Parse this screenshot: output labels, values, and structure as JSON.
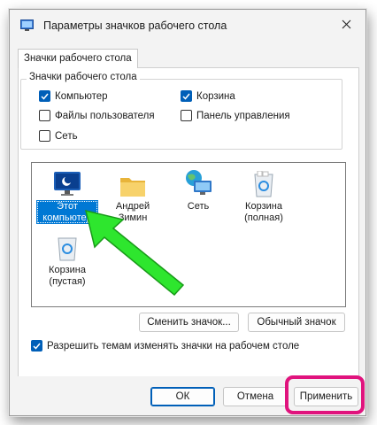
{
  "window": {
    "title": "Параметры значков рабочего стола"
  },
  "tab": {
    "label": "Значки рабочего стола"
  },
  "group": {
    "legend": "Значки рабочего стола",
    "checkboxes": [
      {
        "label": "Компьютер",
        "checked": true
      },
      {
        "label": "Корзина",
        "checked": true
      },
      {
        "label": "Файлы пользователя",
        "checked": false
      },
      {
        "label": "Панель управления",
        "checked": false
      },
      {
        "label": "Сеть",
        "checked": false
      }
    ]
  },
  "icons": [
    {
      "label": "Этот компьютер",
      "icon": "monitor-icon",
      "selected": true
    },
    {
      "label": "Андрей Зимин",
      "icon": "folder-icon",
      "selected": false
    },
    {
      "label": "Сеть",
      "icon": "network-icon",
      "selected": false
    },
    {
      "label": "Корзина (полная)",
      "icon": "recycle-bin-full-icon",
      "selected": false
    },
    {
      "label": "Корзина (пустая)",
      "icon": "recycle-bin-empty-icon",
      "selected": false
    }
  ],
  "buttons": {
    "change_icon": "Сменить значок...",
    "default_icon": "Обычный значок",
    "ok": "ОК",
    "cancel": "Отмена",
    "apply": "Применить"
  },
  "allow_themes": {
    "label": "Разрешить темам изменять значки на рабочем столе",
    "checked": true
  },
  "colors": {
    "accent": "#005fb8",
    "highlight": "#e0137d",
    "arrow": "#2ee62e"
  }
}
